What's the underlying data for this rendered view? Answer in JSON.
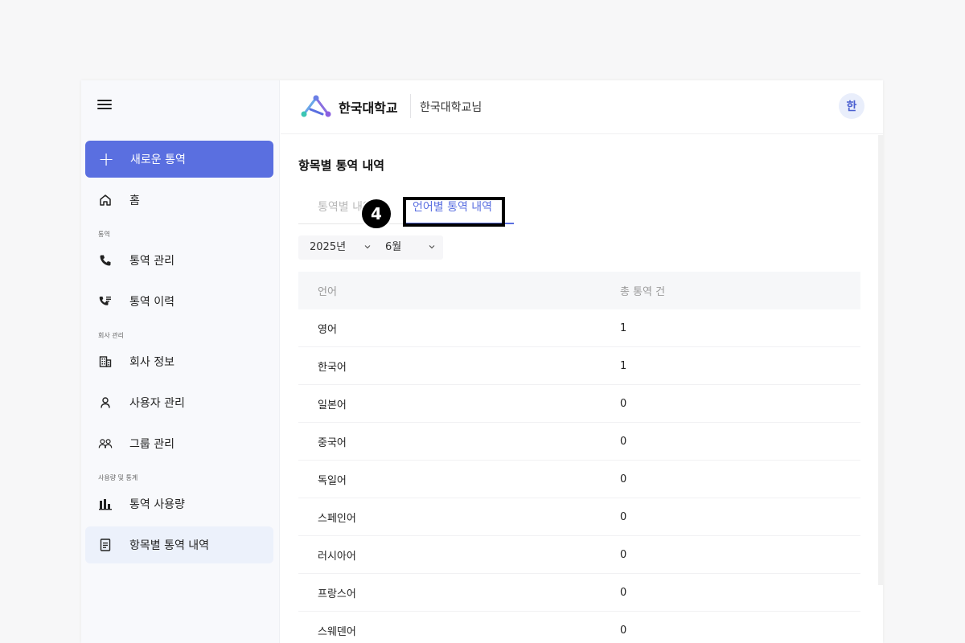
{
  "sidebar": {
    "new_button": "새로운 통역",
    "home": "홈",
    "sections": {
      "call": "통역",
      "company": "회사 관리",
      "usage": "사용량 및 통계"
    },
    "items": {
      "call_manage": "통역 관리",
      "call_history": "통역 이력",
      "company_info": "회사 정보",
      "user_manage": "사용자 관리",
      "group_manage": "그룹 관리",
      "usage": "통역 사용량",
      "by_item": "항목별 통역 내역"
    }
  },
  "header": {
    "brand": "한국대학교",
    "user": "한국대학교님",
    "avatar": "한"
  },
  "main": {
    "title": "항목별 통역 내역",
    "tabs": [
      "통역별 내역",
      "언어별 통역 내역"
    ],
    "active_tab": 1,
    "step_badge": "4",
    "filters": {
      "year": "2025년",
      "month": "6월"
    },
    "table": {
      "headers": [
        "언어",
        "총 통역 건"
      ],
      "rows": [
        [
          "영어",
          "1"
        ],
        [
          "한국어",
          "1"
        ],
        [
          "일본어",
          "0"
        ],
        [
          "중국어",
          "0"
        ],
        [
          "독일어",
          "0"
        ],
        [
          "스페인어",
          "0"
        ],
        [
          "러시아어",
          "0"
        ],
        [
          "프랑스어",
          "0"
        ],
        [
          "스웨덴어",
          "0"
        ]
      ]
    }
  },
  "colors": {
    "accent": "#5a6fe0",
    "active_bg": "#ecf1fb",
    "sidebar_bg": "#f8f9fc"
  }
}
